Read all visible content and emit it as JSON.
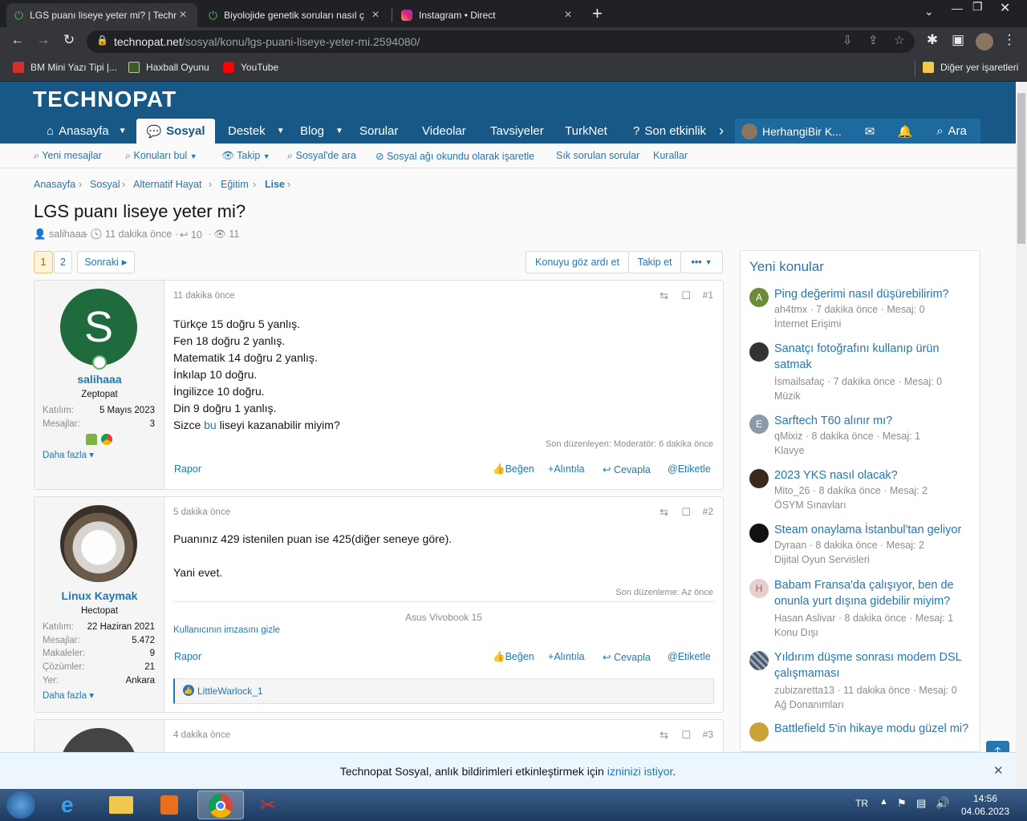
{
  "browser": {
    "tabs": [
      {
        "title": "LGS puanı liseye yeter mi? | Techn",
        "active": true
      },
      {
        "title": "Biyolojide genetik soruları nasıl ç",
        "active": false
      },
      {
        "title": "Instagram • Direct",
        "active": false
      }
    ],
    "new_tab": "+",
    "url_host": "technopat.net",
    "url_path": "/sosyal/konu/lgs-puani-liseye-yeter-mi.2594080/",
    "bookmarks": [
      "BM Mini Yazı Tipi |...",
      "Haxball Oyunu",
      "YouTube"
    ],
    "other_bookmarks": "Diğer yer işaretleri"
  },
  "site": {
    "logo": "TECHNOPAT",
    "nav": [
      "Anasayfa",
      "Sosyal",
      "Destek",
      "Blog",
      "Sorular",
      "Videolar",
      "Tavsiyeler",
      "TurkNet",
      "Son etkinlik"
    ],
    "user": "HerhangiBir K...",
    "search": "Ara",
    "subnav": [
      "Yeni mesajlar",
      "Konuları bul",
      "Takip",
      "Sosyal'de ara",
      "Sosyal ağı okundu olarak işaretle",
      "Sık sorulan sorular",
      "Kurallar"
    ]
  },
  "breadcrumb": [
    "Anasayfa",
    "Sosyal",
    "Alternatif Hayat",
    "Eğitim",
    "Lise"
  ],
  "thread": {
    "title": "LGS puanı liseye yeter mi?",
    "author": "salihaaa",
    "time": "11 dakika önce",
    "replies": "10",
    "views": "11",
    "pages": [
      "1",
      "2"
    ],
    "next": "Sonraki",
    "ignore": "Konuyu göz ardı et",
    "watch": "Takip et",
    "more": "•••"
  },
  "posts": [
    {
      "time": "11 dakika önce",
      "num": "#1",
      "user": "salihaaa",
      "initial": "S",
      "role": "Zeptopat",
      "stats": [
        [
          "Katılım:",
          "5 Mayıs 2023"
        ],
        [
          "Mesajlar:",
          "3"
        ]
      ],
      "more": "Daha fazla",
      "lines": [
        "Türkçe 15 doğru 5 yanlış.",
        "Fen 18 doğru 2 yanlış.",
        "Matematik 14 doğru 2 yanlış.",
        "İnkılap 10 doğru.",
        "İngilizce 10 doğru.",
        "Din 9 doğru 1 yanlış."
      ],
      "last_pre": "Sizce ",
      "last_link": "bu",
      "last_post": " liseyi kazanabilir miyim?",
      "edited": "Son düzenleyen: Moderatör: 6 dakika önce"
    },
    {
      "time": "5 dakika önce",
      "num": "#2",
      "user": "Linux Kaymak",
      "role": "Hectopat",
      "stats": [
        [
          "Katılım:",
          "22 Haziran 2021"
        ],
        [
          "Mesajlar:",
          "5.472"
        ],
        [
          "Makaleler:",
          "9"
        ],
        [
          "Çözümler:",
          "21"
        ],
        [
          "Yer:",
          "Ankara"
        ]
      ],
      "more": "Daha fazla",
      "lines": [
        "Puanınız 429 istenilen puan ise 425(diğer seneye göre).",
        "Yani evet."
      ],
      "edited": "Son düzenleme: Az önce",
      "signature": "Asus Vivobook 15",
      "hide_sig": "Kullanıcının imzasını gizle",
      "reaction": "LittleWarlock_1"
    },
    {
      "time": "4 dakika önce",
      "num": "#3"
    }
  ],
  "actions": {
    "report": "Rapor",
    "like": "Beğen",
    "quote": "Alıntıla",
    "reply": "Cevapla",
    "tag": "Etiketle"
  },
  "sidebar": {
    "title": "Yeni konular",
    "items": [
      {
        "title": "Ping değerimi nasıl düşürebilirim?",
        "meta": "ah4tmx · 7 dakika önce · Mesaj: 0",
        "forum": "İnternet Erişimi",
        "initial": "A",
        "color": "#6b8c3a"
      },
      {
        "title": "Sanatçı fotoğrafını kullanıp ürün satmak",
        "meta": "İsmailsafaç · 7 dakika önce · Mesaj: 0",
        "forum": "Müzik",
        "initial": "",
        "color": "#333333"
      },
      {
        "title": "Sarftech T60 alınır mı?",
        "meta": "qMixiz · 8 dakika önce · Mesaj: 1",
        "forum": "Klavye",
        "initial": "E",
        "color": "#8b9aa8"
      },
      {
        "title": "2023 YKS nasıl olacak?",
        "meta": "Mito_26 · 8 dakika önce · Mesaj: 2",
        "forum": "ÖSYM Sınavları",
        "initial": "",
        "color": "#3a2a1c"
      },
      {
        "title": "Steam onaylama İstanbul'tan geliyor",
        "meta": "Dyraan · 8 dakika önce · Mesaj: 2",
        "forum": "Dijital Oyun Servisleri",
        "initial": "",
        "color": "#111111"
      },
      {
        "title": "Babam Fransa'da çalışıyor, ben de onunla yurt dışına gidebilir miyim?",
        "meta": "Hasan Aslivar · 8 dakika önce · Mesaj: 1",
        "forum": "Konu Dışı",
        "initial": "H",
        "color": "#e8cfcf"
      },
      {
        "title": "Yıldırım düşme sonrası modem DSL çalışmaması",
        "meta": "zubizaretta13 · 11 dakika önce · Mesaj: 0",
        "forum": "Ağ Donanımları",
        "initial": "",
        "color": "#4a5a6a"
      },
      {
        "title": "Battlefield 5'in hikaye modu güzel mi?",
        "meta": "",
        "forum": "",
        "initial": "",
        "color": "#c9a23a"
      }
    ]
  },
  "notice": {
    "pre": "Technopat Sosyal, anlık bildirimleri etkinleştirmek için ",
    "link": "izninizi istiyor",
    "post": "."
  },
  "taskbar": {
    "lang": "TR",
    "time": "14:56",
    "date": "04.06.2023"
  }
}
